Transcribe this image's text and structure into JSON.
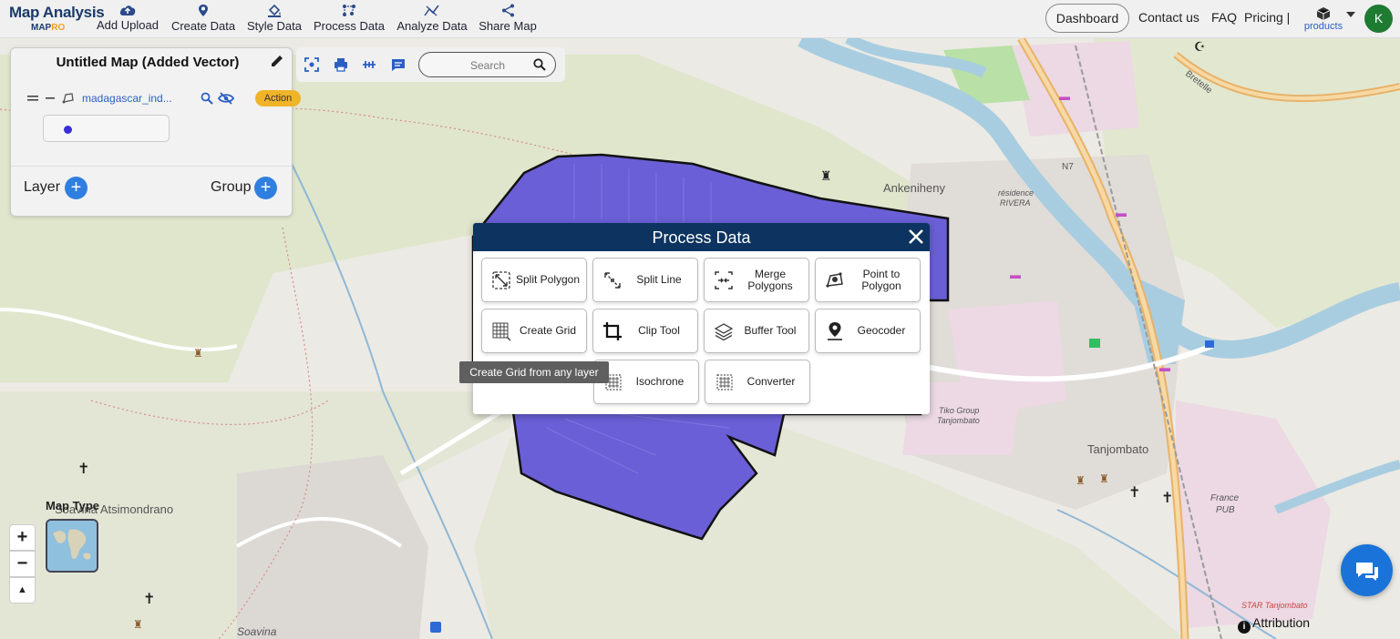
{
  "app": {
    "logo_title": "Map Analysis",
    "logo_sub_a": "MAP",
    "logo_sub_b": "RO"
  },
  "nav": {
    "items": [
      {
        "label": "Add Upload",
        "icon": "cloud-upload-icon"
      },
      {
        "label": "Create Data",
        "icon": "map-pin-icon"
      },
      {
        "label": "Style Data",
        "icon": "paint-bucket-icon"
      },
      {
        "label": "Process Data",
        "icon": "process-nodes-icon"
      },
      {
        "label": "Analyze Data",
        "icon": "analyze-chart-icon"
      },
      {
        "label": "Share Map",
        "icon": "share-icon"
      }
    ],
    "dashboard": "Dashboard",
    "contact": "Contact us",
    "faq": "FAQ",
    "pricing": "Pricing |",
    "products": "products",
    "avatar_initial": "K"
  },
  "layer_panel": {
    "title": "Untitled Map (Added Vector)",
    "layer_name": "madagascar_ind...",
    "action_label": "Action",
    "layer_label": "Layer",
    "group_label": "Group",
    "legend_color": "#3a2fd6"
  },
  "map_tools": {
    "search_placeholder": "Search"
  },
  "dialog": {
    "title": "Process Data",
    "tools": [
      {
        "label": "Split Polygon",
        "icon": "split-polygon-icon"
      },
      {
        "label": "Split Line",
        "icon": "split-line-icon"
      },
      {
        "label": "Merge Polygons",
        "icon": "merge-polygons-icon"
      },
      {
        "label": "Point to Polygon",
        "icon": "point-to-polygon-icon"
      },
      {
        "label": "Create Grid",
        "icon": "grid-icon"
      },
      {
        "label": "Clip Tool",
        "icon": "crop-icon"
      },
      {
        "label": "Buffer Tool",
        "icon": "layers-icon"
      },
      {
        "label": "Geocoder",
        "icon": "location-pin-icon"
      },
      {
        "label": "Isochrone",
        "icon": "isochrone-icon"
      },
      {
        "label": "Converter",
        "icon": "converter-icon"
      }
    ],
    "tooltip": "Create Grid from any layer"
  },
  "map": {
    "labels": {
      "ankeniheny": "Ankeniheny",
      "residence": "résidence",
      "rivera": "RIVERA",
      "n7": "N7",
      "tanjombato": "Tanjombato",
      "tiko": "Tiko Group",
      "tiko2": "Tanjombato",
      "atsimondrano": "Soavina Atsimondrano",
      "soavina": "Soavina",
      "france": "France",
      "pub": "PUB",
      "star": "STAR Tanjombato",
      "bretelle": "Bretelle"
    },
    "polygon_color": "#6a5fd6",
    "river_color": "#a8cde0",
    "road_color": "#e8b26a"
  },
  "controls": {
    "map_type": "Map Type",
    "zoom_in": "+",
    "zoom_out": "−",
    "north": "▲",
    "attribution": "Attribution"
  }
}
